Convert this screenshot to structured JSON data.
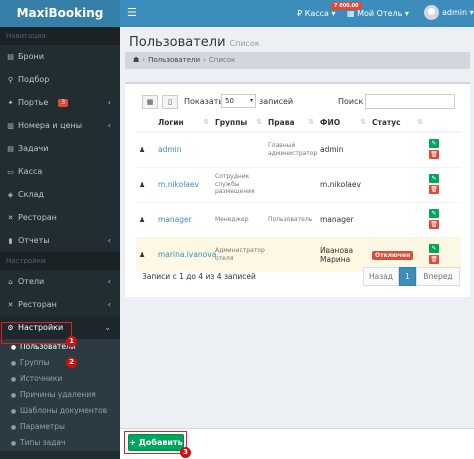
{
  "header": {
    "logo": "MaxiBooking",
    "burger_icon": "☰",
    "kassa_label": "₽ Касса ▾",
    "kassa_badge": "7 000.00",
    "hotel_label": "▦ Мой Отель ▾",
    "admin_label": "admin ▾"
  },
  "sidebar": {
    "nav_header": "Навигация",
    "items": [
      {
        "icon": "▤",
        "label": "Брони"
      },
      {
        "icon": "⚲",
        "label": "Подбор"
      },
      {
        "icon": "✦",
        "label": "Портье",
        "badge": "3",
        "chevron": "‹"
      },
      {
        "icon": "▥",
        "label": "Номера и цены",
        "chevron": "‹"
      },
      {
        "icon": "▤",
        "label": "Задачи"
      },
      {
        "icon": "▭",
        "label": "Касса"
      },
      {
        "icon": "◈",
        "label": "Склад"
      },
      {
        "icon": "✕",
        "label": "Ресторан"
      },
      {
        "icon": "▮",
        "label": "Отчеты",
        "chevron": "‹"
      }
    ],
    "settings_header": "Настройки",
    "settings_items": [
      {
        "icon": "⌂",
        "label": "Отели",
        "chevron": "‹"
      },
      {
        "icon": "✕",
        "label": "Ресторан",
        "chevron": "‹"
      },
      {
        "icon": "⚙",
        "label": "Настройки",
        "chevron": "⌄"
      }
    ],
    "sub_items": [
      {
        "icon": "●",
        "label": "Пользователи"
      },
      {
        "icon": "●",
        "label": "Группы"
      },
      {
        "icon": "●",
        "label": "Источники"
      },
      {
        "icon": "●",
        "label": "Причины удаления"
      },
      {
        "icon": "●",
        "label": "Шаблоны документов"
      },
      {
        "icon": "●",
        "label": "Параметры"
      },
      {
        "icon": "●",
        "label": "Типы задач"
      }
    ]
  },
  "markers": [
    "1",
    "2",
    "3"
  ],
  "page": {
    "title": "Пользователи",
    "subtitle": "Список",
    "breadcrumb_home_icon": "☗",
    "breadcrumb": [
      "Пользователи",
      "Список"
    ]
  },
  "table_controls": {
    "show_label": "Показать",
    "length_value": "50",
    "records_label": "записей",
    "search_label": "Поиск",
    "search_value": ""
  },
  "columns": [
    "Логин",
    "Группы",
    "Права",
    "ФИО",
    "Статус"
  ],
  "rows": [
    {
      "login": "admin",
      "groups": "",
      "rights": "Главный администратор",
      "name": "admin",
      "status": ""
    },
    {
      "login": "m.nikolaev",
      "groups": "Сотрудник службы размещения",
      "rights": "",
      "name": "m.nikolaev",
      "status": ""
    },
    {
      "login": "manager",
      "groups": "Менеджер",
      "rights": "Пользователь",
      "name": "manager",
      "status": ""
    },
    {
      "login": "marina.ivanova",
      "groups": "Администратор отеля",
      "rights": "",
      "name": "Иванова Марина",
      "status": "Отключен"
    }
  ],
  "footer": {
    "info": "Записи с 1 до 4 из 4 записей",
    "prev": "Назад",
    "page": "1",
    "next": "Вперед",
    "add_button": "+ Добавить"
  },
  "colors": {
    "header": "#3c8dbc",
    "sidebar": "#222d32",
    "success": "#00a65a",
    "danger": "#dd4b39",
    "annotation": "#cc1111"
  }
}
